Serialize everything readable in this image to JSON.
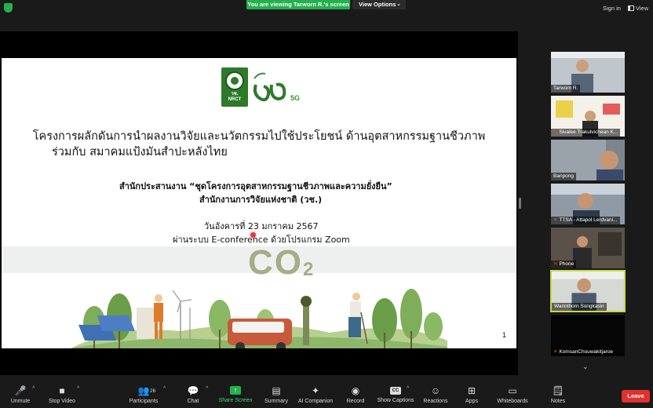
{
  "topbar": {
    "viewing_banner": "You are viewing Tarworn R.'s screen",
    "view_options": "View Options",
    "sign_in": "Sign in",
    "view": "View"
  },
  "slide": {
    "logo_abbr_top": "วช.",
    "logo_abbr_bottom": "NRCT",
    "title_line1": "โครงการผลักดันการนำผลงานวิจัยและนวัตกรรมไปใช้ประโยชน์ ด้านอุตสาหกรรมฐานชีวภาพ",
    "title_line2": "ร่วมกับ สมาคมแป้งมันสำปะหลังไทย",
    "coordinator_line1": "สำนักประสานงาน “ชุดโครงการอุตสาหกรรมฐานชีวภาพและความยั่งยืน”",
    "coordinator_line2": "สำนักงานการวิจัยแห่งชาติ (วช.)",
    "date_line": "วันอังคารที่ 23 มกราคม 2567",
    "via_line": "ผ่านระบบ E-conference ด้วยโปรแกรม Zoom",
    "co2": "CO",
    "co2_sub": "2",
    "page_number": "1"
  },
  "participants": [
    {
      "name": "Tarworn R.",
      "muted": false
    },
    {
      "name": "Sivalee Trakulvichean K...",
      "muted": true
    },
    {
      "name": "Banpong",
      "muted": false
    },
    {
      "name": "TTSA - Attapol Lerdvani...",
      "muted": true
    },
    {
      "name": "Phone",
      "muted": true
    },
    {
      "name": "Warinthorn Songkasiri",
      "muted": false
    },
    {
      "name": "KomsanChouwakitjaroe",
      "muted": true
    }
  ],
  "toolbar": {
    "unmute": "Unmute",
    "stop_video": "Stop Video",
    "participants": "Participants",
    "participants_count": "26",
    "chat": "Chat",
    "share_screen": "Share Screen",
    "summary": "Summary",
    "ai_companion": "AI Companion",
    "record": "Record",
    "show_captions": "Show Captions",
    "cc": "CC",
    "reactions": "Reactions",
    "apps": "Apps",
    "whiteboards": "Whiteboards",
    "notes": "Notes",
    "leave": "Leave"
  },
  "colors": {
    "accent_green": "#23b14d",
    "leave_red": "#e0322f",
    "active_speaker_border": "#c8d84b"
  }
}
